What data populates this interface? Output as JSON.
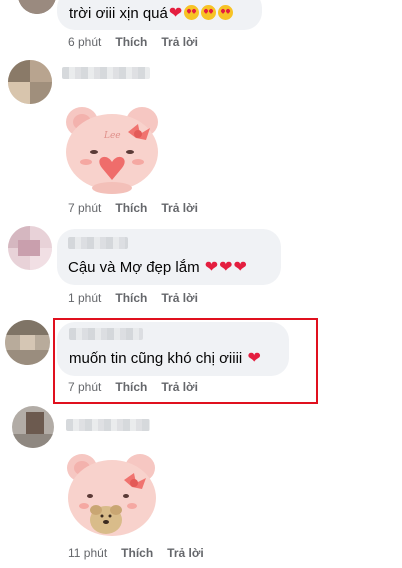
{
  "comments": [
    {
      "text": "trời ơiii xịn quá",
      "time": "6 phút",
      "like": "Thích",
      "reply": "Trả lời"
    },
    {
      "time": "7 phút",
      "like": "Thích",
      "reply": "Trả lời"
    },
    {
      "text": "Cậu và Mợ đẹp lắm",
      "time": "1 phút",
      "like": "Thích",
      "reply": "Trả lời"
    },
    {
      "text": "muốn tin cũng khó chị ơiiii",
      "time": "7 phút",
      "like": "Thích",
      "reply": "Trả lời"
    },
    {
      "time": "11 phút",
      "like": "Thích",
      "reply": "Trả lời"
    }
  ],
  "sticker_caption": "Lee",
  "colors": {
    "bubble": "#f0f2f5",
    "highlight": "#e0101e",
    "heart": "#e41e3f",
    "meta": "#65676b"
  }
}
